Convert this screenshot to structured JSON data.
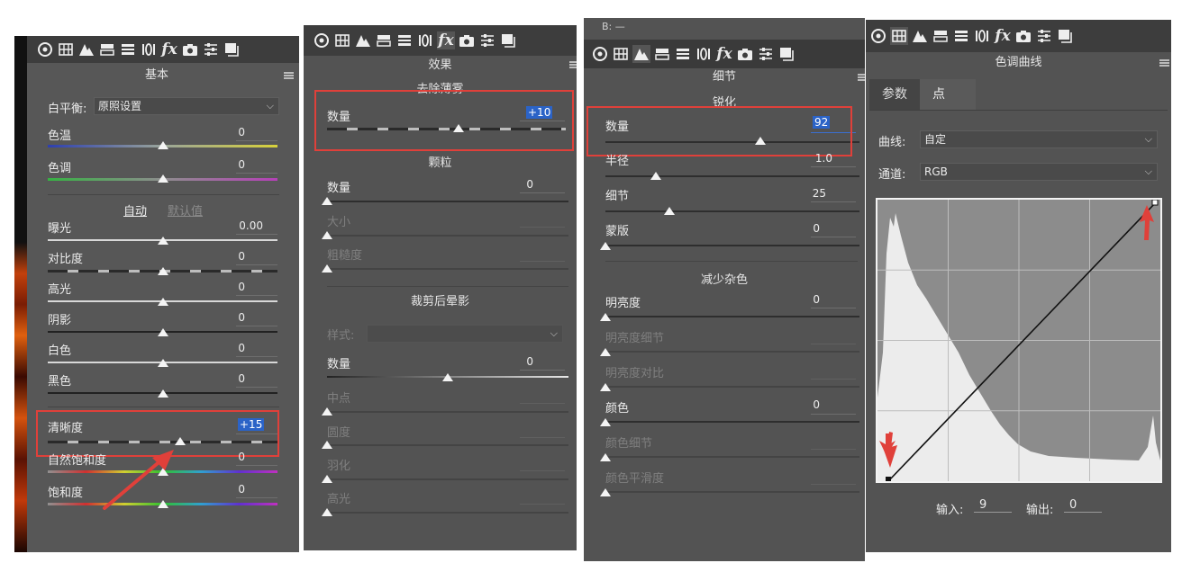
{
  "panel1": {
    "title": "基本",
    "white_balance": {
      "label": "白平衡:",
      "value": "原照设置"
    },
    "temp": {
      "label": "色温",
      "value": "0"
    },
    "tint": {
      "label": "色调",
      "value": "0"
    },
    "auto_label": "自动",
    "default_label": "默认值",
    "exposure": {
      "label": "曝光",
      "value": "0.00"
    },
    "contrast": {
      "label": "对比度",
      "value": "0"
    },
    "highlights": {
      "label": "高光",
      "value": "0"
    },
    "shadows": {
      "label": "阴影",
      "value": "0"
    },
    "whites": {
      "label": "白色",
      "value": "0"
    },
    "blacks": {
      "label": "黑色",
      "value": "0"
    },
    "clarity": {
      "label": "清晰度",
      "value": "+15"
    },
    "vibrance": {
      "label": "自然饱和度",
      "value": "0"
    },
    "saturation": {
      "label": "饱和度",
      "value": "0"
    }
  },
  "panel2": {
    "title": "效果",
    "dehaze": {
      "section": "去除薄雾",
      "label": "数量",
      "value": "+10"
    },
    "grain": {
      "section": "颗粒",
      "amount_label": "数量",
      "amount_value": "0",
      "size_label": "大小",
      "roughness_label": "粗糙度"
    },
    "vignette": {
      "section": "裁剪后晕影",
      "style_label": "样式:",
      "amount_label": "数量",
      "amount_value": "0",
      "midpoint_label": "中点",
      "roundness_label": "圆度",
      "feather_label": "羽化",
      "highlights_label": "高光"
    }
  },
  "panel3": {
    "top_label": "B: —",
    "title": "细节",
    "sharpen": {
      "section": "锐化",
      "amount_label": "数量",
      "amount_value": "92",
      "radius_label": "半径",
      "radius_value": "1.0",
      "detail_label": "细节",
      "detail_value": "25",
      "masking_label": "蒙版",
      "masking_value": "0"
    },
    "noise": {
      "section": "减少杂色",
      "lum_label": "明亮度",
      "lum_value": "0",
      "lum_detail_label": "明亮度细节",
      "lum_contrast_label": "明亮度对比",
      "color_label": "颜色",
      "color_value": "0",
      "color_detail_label": "颜色细节",
      "color_smooth_label": "颜色平滑度"
    }
  },
  "panel4": {
    "title": "色调曲线",
    "tabs": [
      "参数",
      "点"
    ],
    "curve": {
      "label": "曲线:",
      "value": "自定"
    },
    "channel": {
      "label": "通道:",
      "value": "RGB"
    },
    "input_label": "输入:",
    "input_value": "9",
    "output_label": "输出:",
    "output_value": "0"
  },
  "slider_levels": {
    "temp": 0.5,
    "tint": 0.5,
    "exposure": 0.5,
    "contrast": 0.5,
    "highlights": 0.5,
    "shadows": 0.5,
    "whites": 0.5,
    "blacks": 0.5,
    "clarity": 0.575,
    "vibrance": 0.5,
    "saturation": 0.5,
    "dehaze": 0.55,
    "grain_amount": 0,
    "grain_size": 0,
    "grain_roughness": 0,
    "vignette_amount": 0.5,
    "vignette_midpoint": 0,
    "vignette_roundness": 0,
    "vignette_feather": 0,
    "vignette_highlights": 0,
    "sharpen_amount": 0.61,
    "sharpen_radius": 0.2,
    "sharpen_detail": 0.25,
    "sharpen_masking": 0,
    "nr_lum": 0,
    "nr_lum_detail": 0,
    "nr_lum_contrast": 0,
    "nr_color": 0,
    "nr_color_detail": 0,
    "nr_color_smooth": 0
  },
  "colors": {
    "panel_bg": "#535353",
    "toolbar_bg": "#3d3d3d",
    "highlight_blue": "#2b63c7",
    "annotation_red": "#e0403a"
  }
}
